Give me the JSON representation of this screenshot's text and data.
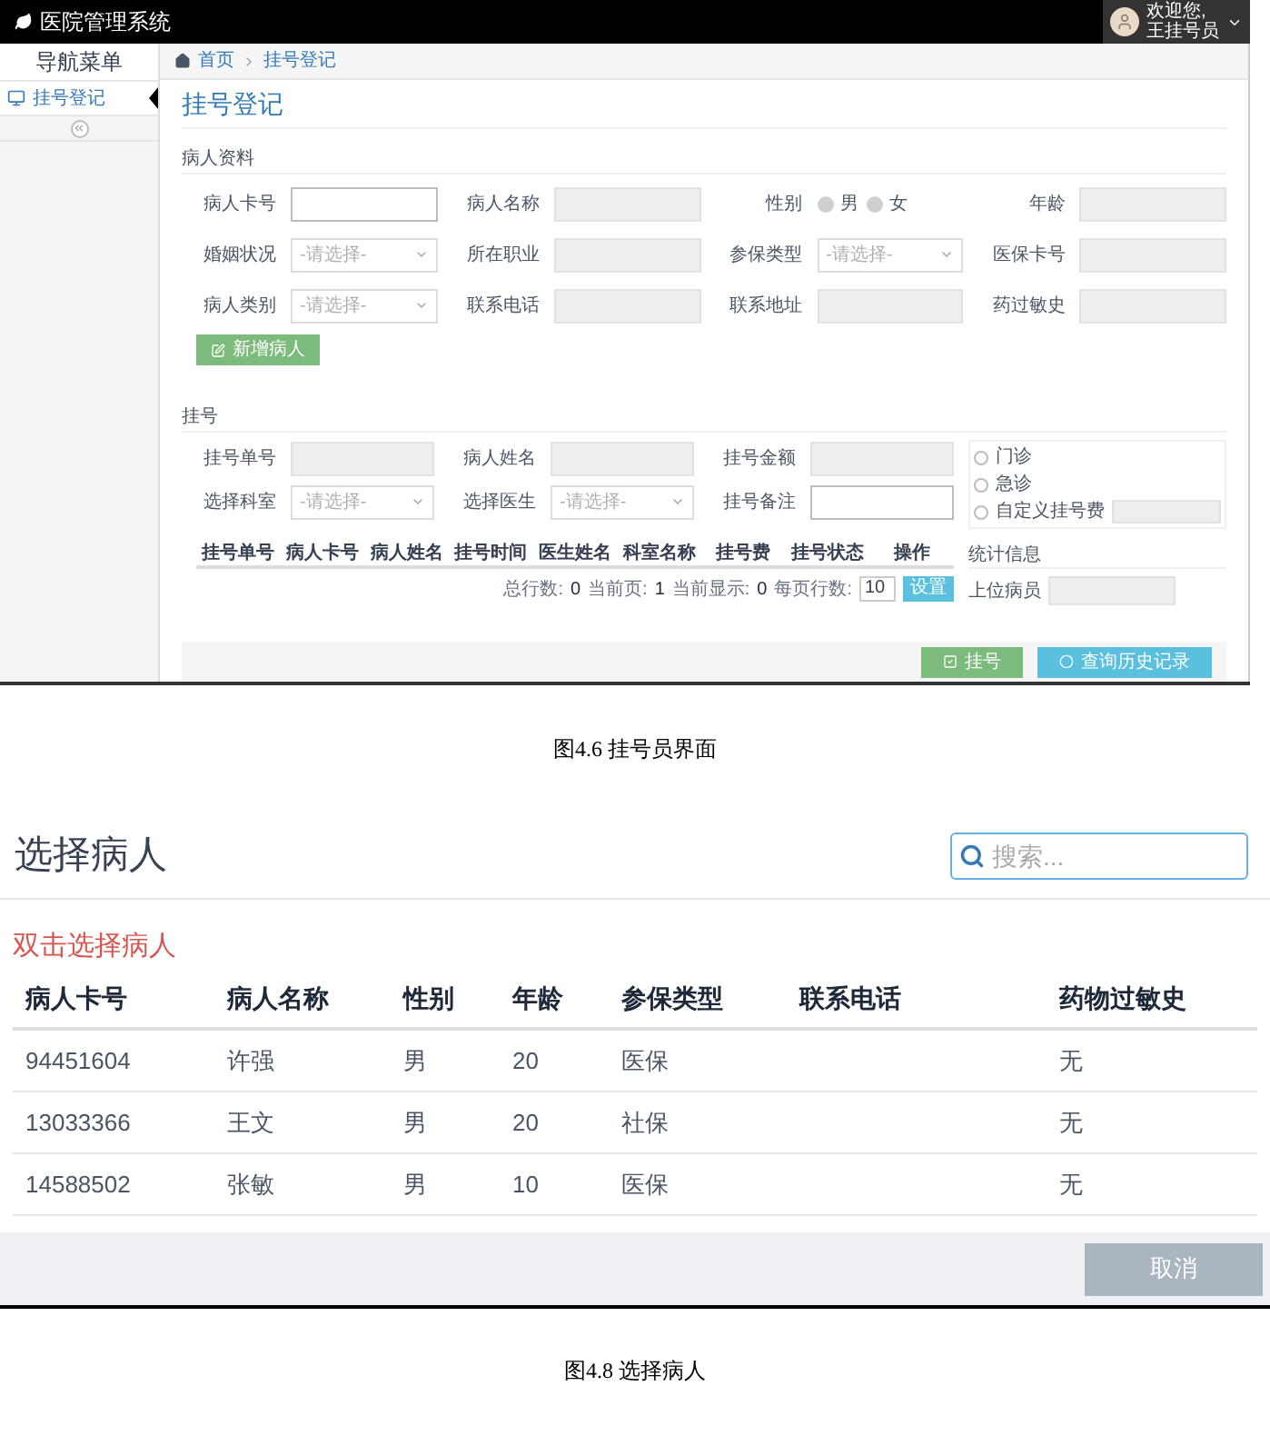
{
  "figure1": {
    "app_title": "医院管理系统",
    "user": {
      "greeting": "欢迎您,",
      "name": "王挂号员"
    },
    "sidebar": {
      "title": "导航菜单",
      "items": [
        {
          "label": "挂号登记",
          "selected": true
        }
      ]
    },
    "breadcrumb": [
      "首页",
      "挂号登记"
    ],
    "page_title": "挂号登记",
    "patient": {
      "title": "病人资料",
      "fields": [
        {
          "kind": "input",
          "label": "病人卡号",
          "disabled": false
        },
        {
          "kind": "input",
          "label": "病人名称",
          "disabled": true
        },
        {
          "kind": "radio",
          "label": "性别",
          "options": [
            {
              "label": "男",
              "selected": false
            },
            {
              "label": "女",
              "selected": false
            }
          ]
        },
        {
          "kind": "input",
          "label": "年龄",
          "disabled": true
        },
        {
          "kind": "select",
          "label": "婚姻状况",
          "placeholder": "-请选择-"
        },
        {
          "kind": "input",
          "label": "所在职业",
          "disabled": true
        },
        {
          "kind": "select",
          "label": "参保类型",
          "placeholder": "-请选择-"
        },
        {
          "kind": "input",
          "label": "医保卡号",
          "disabled": true
        },
        {
          "kind": "select",
          "label": "病人类别",
          "placeholder": "-请选择-"
        },
        {
          "kind": "input",
          "label": "联系电话",
          "disabled": true
        },
        {
          "kind": "input",
          "label": "联系地址",
          "disabled": true
        },
        {
          "kind": "input",
          "label": "药过敏史",
          "disabled": true
        }
      ],
      "button": "新增病人"
    },
    "register": {
      "title": "挂号",
      "fields": [
        {
          "kind": "input",
          "label": "挂号单号",
          "disabled": true
        },
        {
          "kind": "input",
          "label": "病人姓名",
          "disabled": true
        },
        {
          "kind": "input",
          "label": "挂号金额",
          "disabled": true
        },
        {
          "kind": "select",
          "label": "选择科室",
          "placeholder": "-请选择-"
        },
        {
          "kind": "select",
          "label": "选择医生",
          "placeholder": "-请选择-"
        },
        {
          "kind": "input",
          "label": "挂号备注",
          "disabled": false
        }
      ],
      "fee_options": [
        {
          "kind": "preset",
          "label": "门诊",
          "selected": false
        },
        {
          "kind": "preset",
          "label": "急诊",
          "selected": false
        },
        {
          "kind": "custom",
          "label": "自定义挂号费",
          "selected": false
        }
      ],
      "table": {
        "columns": [
          "挂号单号",
          "病人卡号",
          "病人姓名",
          "挂号时间",
          "医生姓名",
          "科室名称",
          "挂号费",
          "挂号状态",
          "操作"
        ]
      },
      "pagination": {
        "total_label": "总行数:",
        "total": "0",
        "page_label": "当前页:",
        "page": "1",
        "shown_label": "当前显示:",
        "shown": "0",
        "rows_label": "每页行数:",
        "rows": "10",
        "button": "设置"
      },
      "stats": {
        "title": "统计信息",
        "fields": [
          {
            "label": "上位病员",
            "disabled": true
          }
        ]
      }
    },
    "footer_buttons": [
      {
        "kind": "success",
        "label": "挂号"
      },
      {
        "kind": "info",
        "label": "查询历史记录"
      }
    ]
  },
  "caption1": "图4.6 挂号员界面",
  "figure2": {
    "title": "选择病人",
    "search": {
      "placeholder": "搜索..."
    },
    "hint": "双击选择病人",
    "columns": [
      "病人卡号",
      "病人名称",
      "性别",
      "年龄",
      "参保类型",
      "联系电话",
      "药物过敏史"
    ],
    "rows": [
      {
        "card_no": "94451604",
        "name": "许强",
        "gender": "男",
        "age": "20",
        "insurance": "医保",
        "allergy": "无"
      },
      {
        "card_no": "13033366",
        "name": "王文",
        "gender": "男",
        "age": "20",
        "insurance": "社保",
        "allergy": "无"
      },
      {
        "card_no": "14588502",
        "name": "张敏",
        "gender": "男",
        "age": "10",
        "insurance": "医保",
        "allergy": "无"
      }
    ],
    "cancel_button": "取消"
  },
  "caption2": "图4.8 选择病人"
}
